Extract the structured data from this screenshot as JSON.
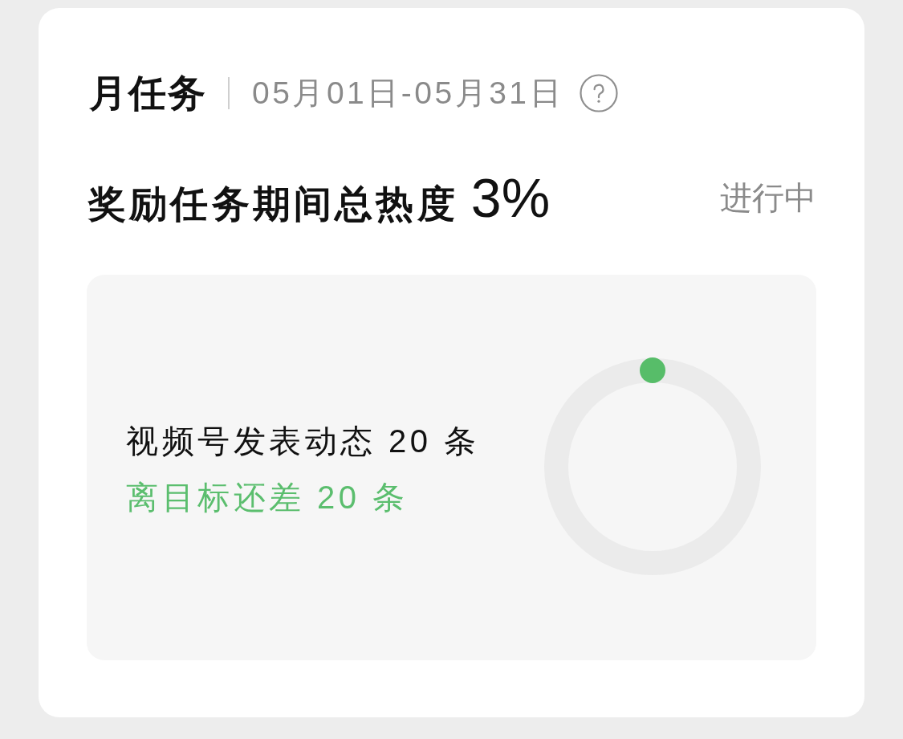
{
  "header": {
    "title": "月任务",
    "date_range": "05月01日-05月31日"
  },
  "summary": {
    "label": "奖励任务期间总热度",
    "value": "3%",
    "status": "进行中"
  },
  "task": {
    "description": "视频号发表动态 20 条",
    "remaining": "离目标还差 20 条"
  }
}
